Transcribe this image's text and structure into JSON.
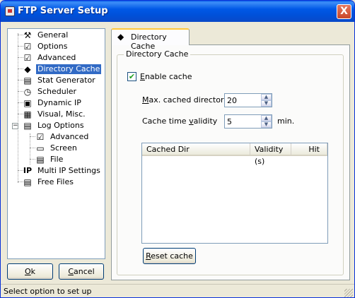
{
  "window": {
    "title": "FTP Server Setup",
    "close_glyph": "X"
  },
  "tree": {
    "items": [
      {
        "label": "General",
        "icon": "tools-icon",
        "glyph": "⚒"
      },
      {
        "label": "Options",
        "icon": "options-icon",
        "glyph": "☑"
      },
      {
        "label": "Advanced",
        "icon": "advanced-icon",
        "glyph": "☑"
      },
      {
        "label": "Directory Cache",
        "icon": "directory-cache-icon",
        "glyph": "◆",
        "selected": true
      },
      {
        "label": "Stat Generator",
        "icon": "stat-generator-icon",
        "glyph": "▤"
      },
      {
        "label": "Scheduler",
        "icon": "scheduler-icon",
        "glyph": "◷"
      },
      {
        "label": "Dynamic IP",
        "icon": "dynamic-ip-icon",
        "glyph": "▣"
      },
      {
        "label": "Visual, Misc.",
        "icon": "visual-icon",
        "glyph": "▦"
      },
      {
        "label": "Log Options",
        "icon": "log-options-icon",
        "glyph": "▤"
      },
      {
        "label": "Advanced",
        "icon": "log-advanced-icon",
        "glyph": "☑"
      },
      {
        "label": "Screen",
        "icon": "screen-icon",
        "glyph": "▭"
      },
      {
        "label": "File",
        "icon": "file-icon",
        "glyph": "▤"
      },
      {
        "label": "Multi IP Settings",
        "icon": "multi-ip-icon",
        "glyph": "IP"
      },
      {
        "label": "Free Files",
        "icon": "free-files-icon",
        "glyph": "▤"
      }
    ],
    "expander_glyph": "−"
  },
  "buttons": {
    "ok_underline": "O",
    "ok_rest": "k",
    "cancel_underline": "C",
    "cancel_rest": "ancel"
  },
  "tab": {
    "label": "Directory Cache"
  },
  "group": {
    "title": "Directory Cache"
  },
  "enable_cache": {
    "underline": "E",
    "rest": "nable cache",
    "checked": true,
    "check_glyph": "✔"
  },
  "max_dirs": {
    "underline": "M",
    "rest": "ax. cached directories",
    "value": "20"
  },
  "validity": {
    "before": "Cache time ",
    "underline": "v",
    "after": "alidity",
    "value": "5",
    "unit": "min."
  },
  "table": {
    "columns": [
      "Cached Dir",
      "Validity (s)",
      "Hit"
    ],
    "rows": []
  },
  "reset": {
    "underline": "R",
    "rest": "eset cache"
  },
  "status": {
    "text": "Select option to set up"
  },
  "colors": {
    "title_bar": "#0058e6",
    "selection": "#316ac5",
    "window_bg": "#ece9d8"
  }
}
